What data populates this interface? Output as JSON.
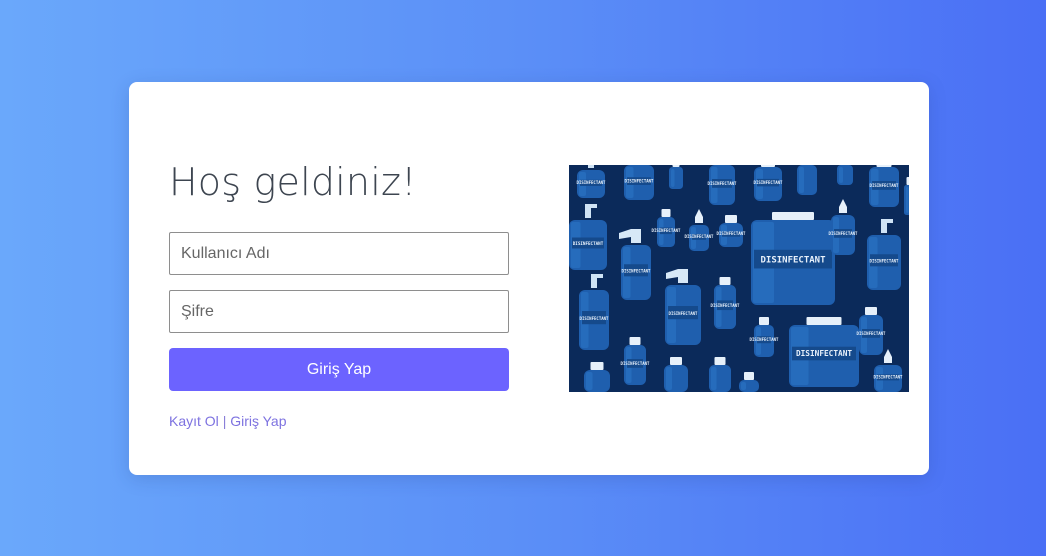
{
  "login": {
    "title": "Hoş geldiniz!",
    "username_placeholder": "Kullanıcı Adı",
    "password_placeholder": "Şifre",
    "submit_label": "Giriş Yap",
    "register_link": "Kayıt Ol",
    "separator": "|",
    "login_link": "Giriş Yap"
  },
  "illustration": {
    "label": "DISINFECTANT",
    "icon": "disinfectant-bottles-illustration"
  },
  "colors": {
    "accent": "#6c63ff",
    "link": "#7d72e0",
    "background_start": "#6aa8fb",
    "background_end": "#4a6ff5",
    "illustration_bg": "#0b2a5a",
    "bottle": "#1f5fae"
  }
}
